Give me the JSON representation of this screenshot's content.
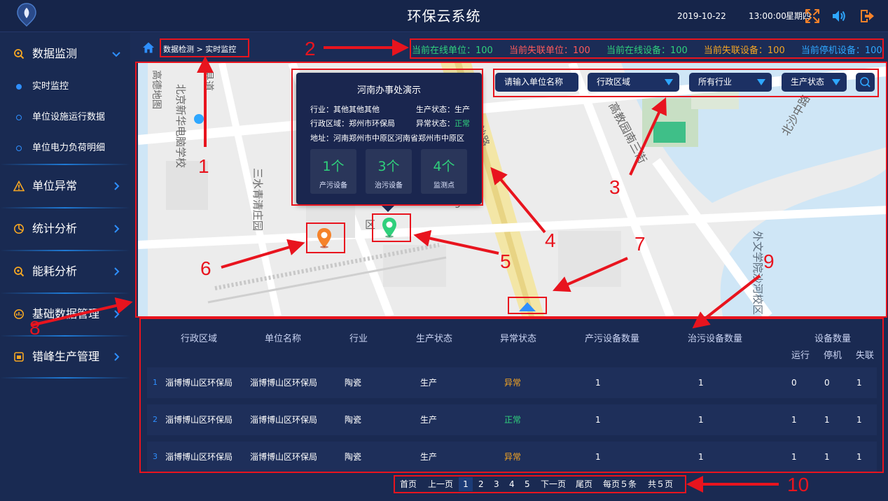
{
  "header": {
    "title": "环保云系统",
    "date": "2019-10-22",
    "time": "13:00:00",
    "weekday": "星期四",
    "icons": [
      "fullscreen-icon",
      "volume-icon",
      "logout-icon"
    ]
  },
  "sidebar": {
    "groups": [
      {
        "label": "数据监测",
        "icon": "search-icon",
        "expanded": true,
        "children": [
          {
            "label": "实时监控",
            "active": true
          },
          {
            "label": "单位设施运行数据",
            "active": false
          },
          {
            "label": "单位电力负荷明细",
            "active": false
          }
        ]
      },
      {
        "label": "单位异常",
        "icon": "warning-icon"
      },
      {
        "label": "统计分析",
        "icon": "pie-icon"
      },
      {
        "label": "能耗分析",
        "icon": "energy-search-icon"
      },
      {
        "label": "基础数据管理",
        "icon": "database-icon"
      },
      {
        "label": "错峰生产管理",
        "icon": "factory-icon"
      }
    ]
  },
  "breadcrumb": "数据检测 > 实时监控",
  "stats": [
    {
      "text": "当前在线单位：100",
      "color": "#2fd07c"
    },
    {
      "text": "当前失联单位：100",
      "color": "#ff5a5a"
    },
    {
      "text": "当前在线设备：100",
      "color": "#2fd07c"
    },
    {
      "text": "当前失联设备：100",
      "color": "#f5a623"
    },
    {
      "text": "当前停机设备：100",
      "color": "#2ea7ff"
    }
  ],
  "filters": {
    "search_placeholder": "请输入单位名称",
    "region": "行政区域",
    "industry": "所有行业",
    "status": "生产状态"
  },
  "map_labels": {
    "school1": "北京新华电脑学校",
    "school1_prefix": "高德地图",
    "road1": "县道",
    "road2": "三水青清庄园",
    "road3": "高教园南三街",
    "road4": "北沙中路",
    "road5": "外文学院沙河校区",
    "road6": "沙路",
    "road7": "区",
    "road8": "9"
  },
  "popup": {
    "title": "河南办事处演示",
    "industry": "行业：其他其他其他",
    "prod_status_label": "生产状态：",
    "prod_status_value": "生产",
    "region": "行政区域：郑州市环保局",
    "abn_status_label": "异常状态：",
    "abn_status_value": "正常",
    "address": "地址：河南郑州市中原区河南省郑州市中原区",
    "cards": [
      {
        "value": "1个",
        "label": "产污设备"
      },
      {
        "value": "3个",
        "label": "治污设备"
      },
      {
        "value": "4个",
        "label": "监测点"
      }
    ]
  },
  "table": {
    "headers": [
      "行政区域",
      "单位名称",
      "行业",
      "生产状态",
      "异常状态",
      "产污设备数量",
      "治污设备数量",
      "设备数量"
    ],
    "sub_headers": [
      "运行",
      "停机",
      "失联"
    ],
    "rows": [
      {
        "no": "1",
        "region": "淄博博山区环保局",
        "name": "淄博博山区环保局",
        "industry": "陶瓷",
        "prod": "生产",
        "abn": "异常",
        "abn_type": "abn",
        "pollute": "1",
        "treat": "1",
        "run": "0",
        "stop": "0",
        "lost": "1"
      },
      {
        "no": "2",
        "region": "淄博博山区环保局",
        "name": "淄博博山区环保局",
        "industry": "陶瓷",
        "prod": "生产",
        "abn": "正常",
        "abn_type": "ok",
        "pollute": "1",
        "treat": "1",
        "run": "1",
        "stop": "1",
        "lost": "1"
      },
      {
        "no": "3",
        "region": "淄博博山区环保局",
        "name": "淄博博山区环保局",
        "industry": "陶瓷",
        "prod": "生产",
        "abn": "异常",
        "abn_type": "abn",
        "pollute": "1",
        "treat": "1",
        "run": "1",
        "stop": "1",
        "lost": "1"
      }
    ]
  },
  "pager": {
    "first": "首页",
    "prev": "上一页",
    "pages": [
      "1",
      "2",
      "3",
      "4",
      "5"
    ],
    "current": "1",
    "next": "下一页",
    "last": "尾页",
    "per_page": "每页５条",
    "total": "共５页"
  },
  "annotations": [
    "1",
    "2",
    "3",
    "4",
    "5",
    "6",
    "7",
    "8",
    "9",
    "10"
  ],
  "colors": {
    "annotation": "#e8141e",
    "accent": "#2e8fff",
    "ok": "#2fd07c",
    "warn": "#f5a623"
  }
}
